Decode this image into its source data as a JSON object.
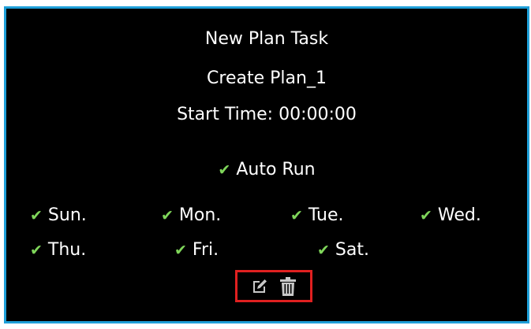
{
  "dialog": {
    "title": "New Plan Task",
    "plan_name": "Create Plan_1",
    "start_time": "Start Time: 00:00:00"
  },
  "auto_run": {
    "label": "Auto Run",
    "checked": true
  },
  "days": [
    {
      "label": "Sun.",
      "checked": true
    },
    {
      "label": "Mon.",
      "checked": true
    },
    {
      "label": "Tue.",
      "checked": true
    },
    {
      "label": "Wed.",
      "checked": true
    },
    {
      "label": "Thu.",
      "checked": true
    },
    {
      "label": "Fri.",
      "checked": true
    },
    {
      "label": "Sat.",
      "checked": true
    }
  ],
  "actions": {
    "edit_icon": "edit-icon",
    "delete_icon": "trash-icon"
  },
  "colors": {
    "background": "#000000",
    "border": "#1e9fd8",
    "check": "#7fd65a",
    "highlight": "#e02020",
    "text": "#ffffff",
    "icon": "#c8c8c8"
  }
}
